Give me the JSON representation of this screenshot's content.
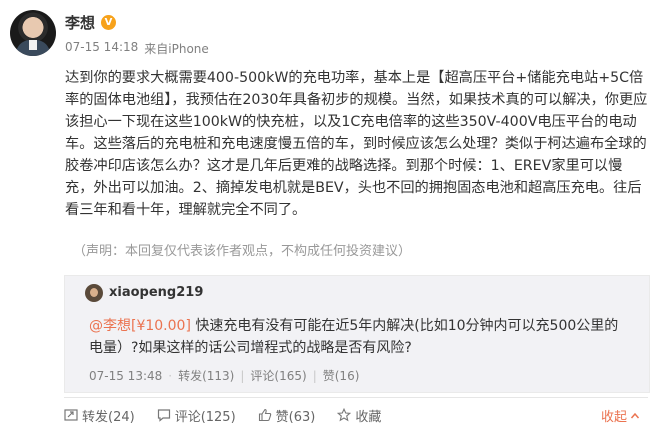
{
  "post": {
    "author": "李想",
    "time": "07-15 14:18",
    "source": "来自iPhone",
    "text": "达到你的要求大概需要400-500kW的充电功率，基本上是【超高压平台+储能充电站+5C倍率的固体电池组】，我预估在2030年具备初步的规模。当然，如果技术真的可以解决，你更应该担心一下现在这些100kW的快充桩，以及1C充电倍率的这些350V-400V电压平台的电动车。这些落后的充电桩和充电速度慢五倍的车，到时候应该怎么处理？类似于柯达遍布全球的胶卷冲印店该怎么办？这才是几年后更难的战略选择。到那个时候：1、EREV家里可以慢充，外出可以加油。2、摘掉发电机就是BEV，头也不回的拥抱固态电池和超高压充电。往后看三年和看十年，理解就完全不同了。",
    "disclaimer": "（声明：本回复仅代表该作者观点，不构成任何投资建议）"
  },
  "reply": {
    "user": "xiaopeng219",
    "mention": "@李想[¥10.00]",
    "text": " 快速充电有没有可能在近5年内解决(比如10分钟内可以充500公里的电量）?如果这样的话公司增程式的战略是否有风险?",
    "time": "07-15 13:48",
    "repost": "转发(113)",
    "comment": "评论(165)",
    "like": "赞(16)"
  },
  "actions": {
    "repost": "转发(24)",
    "comment": "评论(125)",
    "like": "赞(63)",
    "favorite": "收藏",
    "collapse": "收起"
  },
  "colors": {
    "accent": "#eb7350",
    "verified": "#f7a21b",
    "reply_bg": "#f2f2f5"
  }
}
